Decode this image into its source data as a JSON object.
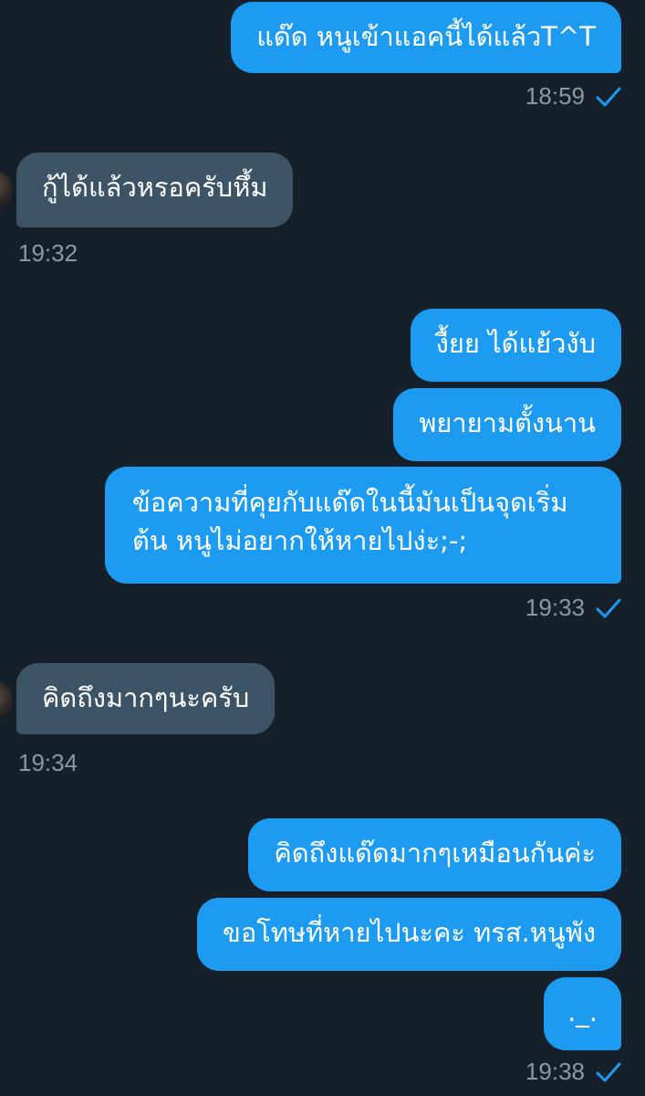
{
  "messages": [
    {
      "text": "แด๊ด หนูเข้าแอคนี้ได้แล้วT^T"
    },
    {
      "text": "กู้ได้แล้วหรอครับหึ้ม"
    },
    {
      "text": "งื้ยย ได้แย้วงับ"
    },
    {
      "text": "พยายามตั้งนาน"
    },
    {
      "text": "ข้อความที่คุยกับแด๊ดในนี้มันเป็นจุดเริ่มต้น หนูไม่อยากให้หายไปง่ะ;-;"
    },
    {
      "text": "คิดถึงมากๆนะครับ"
    },
    {
      "text": "คิดถึงแด๊ดมากๆเหมือนกันค่ะ"
    },
    {
      "text": "ขอโทษที่หายไปนะคะ ทรส.หนูพัง"
    },
    {
      "text": "._."
    }
  ],
  "timestamps": [
    "18:59",
    "19:32",
    "19:33",
    "19:34",
    "19:38"
  ],
  "colors": {
    "background": "#15202b",
    "outgoing_bubble": "#1d9bf0",
    "incoming_bubble": "#3d5466",
    "timestamp": "#8b98a5",
    "read_check": "#1d9bf0"
  },
  "icons": {
    "read_receipt": "check-icon",
    "avatar": "avatar"
  }
}
